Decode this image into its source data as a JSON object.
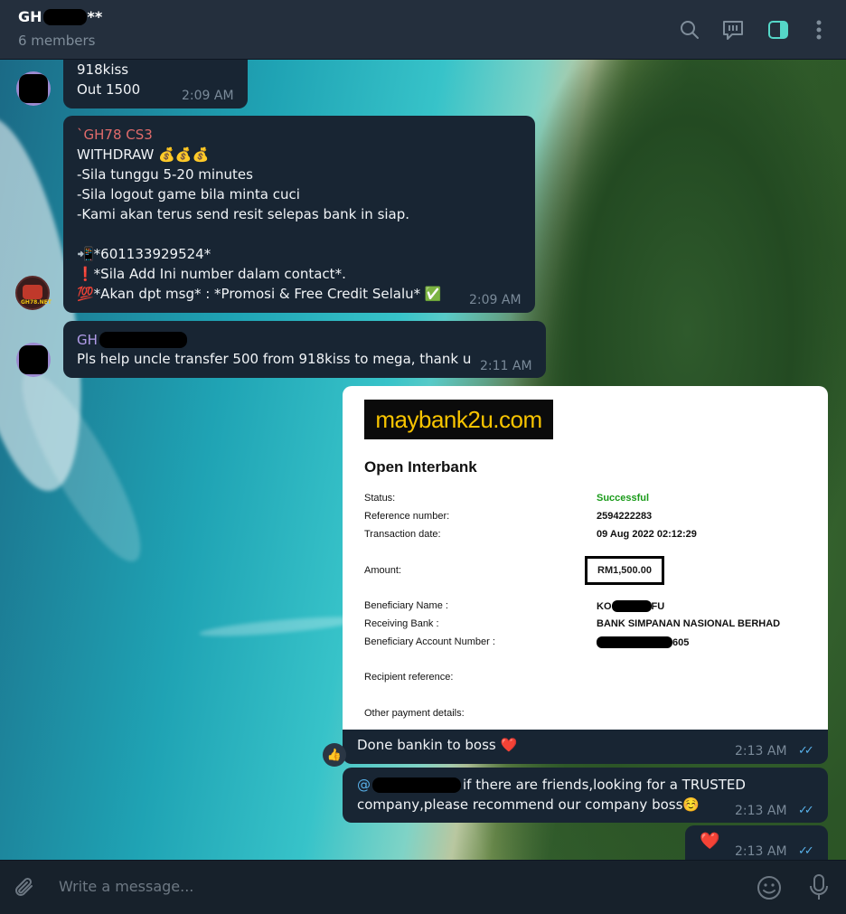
{
  "header": {
    "title_prefix": "GH",
    "title_suffix": "**",
    "subtitle": "6 members",
    "icons": [
      "search-icon",
      "topics-icon",
      "sidebar-toggle-icon",
      "more-icon"
    ]
  },
  "messages": {
    "m1": {
      "line1": "918kiss",
      "line2": "Out 1500",
      "time": "2:09 AM"
    },
    "m2": {
      "sender": "`GH78 CS3",
      "line1": "WITHDRAW 💰💰💰",
      "line2": "-Sila tunggu 5-20 minutes",
      "line3": "-Sila logout game bila minta cuci",
      "line4": "-Kami akan terus send resit selepas bank in siap.",
      "line5": "📲*601133929524*",
      "line6": "❗*Sila Add Ini number dalam contact*.",
      "line7": "💯*Akan dpt msg* : *Promosi & Free Credit Selalu* ✅",
      "time": "2:09 AM"
    },
    "m3": {
      "sender_prefix": "GH",
      "text": "Pls help uncle transfer 500 from 918kiss to mega, thank u",
      "time": "2:11 AM"
    },
    "m4": {
      "caption": "Done bankin to boss ❤️",
      "time": "2:13 AM",
      "reaction": "👍"
    },
    "m5": {
      "mention_prefix": "@",
      "line1": "if there are friends,looking for a TRUSTED",
      "line2": "company,please recommend our company boss☺️",
      "time": "2:13 AM"
    },
    "m6": {
      "text": "❤️",
      "time": "2:13 AM"
    }
  },
  "receipt": {
    "logo": "maybank2u.com",
    "title": "Open Interbank",
    "labels": {
      "status": "Status:",
      "reference": "Reference number:",
      "date": "Transaction date:",
      "amount": "Amount:",
      "beneficiary": "Beneficiary Name :",
      "bank": "Receiving Bank :",
      "account": "Beneficiary Account Number :",
      "recipient_ref": "Recipient reference:",
      "other": "Other payment details:"
    },
    "values": {
      "status": "Successful",
      "reference": "2594222283",
      "date": "09 Aug 2022 02:12:29",
      "amount": "RM1,500.00",
      "beneficiary_prefix": "KO",
      "beneficiary_suffix": "FU",
      "bank": "BANK SIMPANAN NASIONAL BERHAD",
      "account_suffix": "605"
    }
  },
  "composer": {
    "placeholder": "Write a message..."
  },
  "colors": {
    "status_green": "#1a9b1a",
    "logo_yellow": "#f8c400",
    "sender_red": "#e06b6b",
    "sender_purple": "#b29dea",
    "tick_blue": "#58b0e8"
  }
}
